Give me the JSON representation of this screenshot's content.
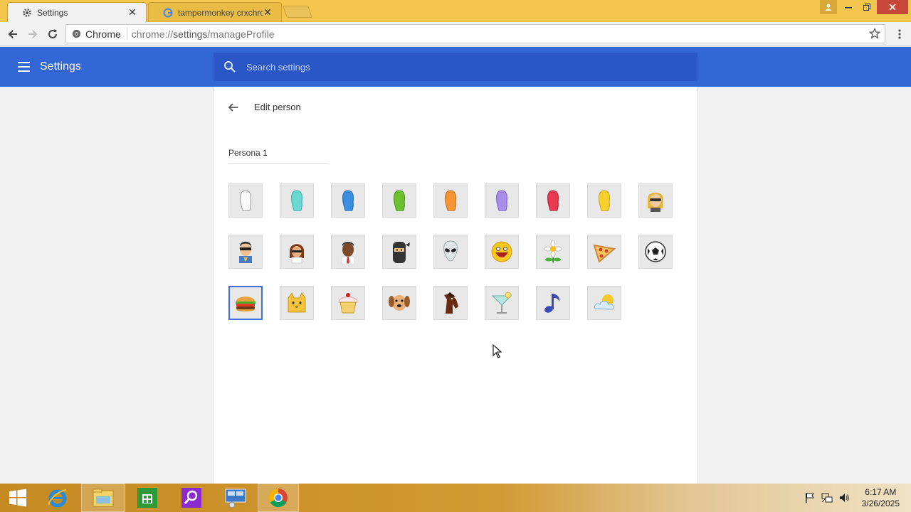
{
  "browser": {
    "tabs": [
      {
        "title": "Settings",
        "close": "✕"
      },
      {
        "title": "tampermonkey crxchrom",
        "close": "✕"
      }
    ],
    "address": {
      "chip_label": "Chrome",
      "url_scheme": "chrome://",
      "url_host": "settings",
      "url_path": "/manageProfile"
    }
  },
  "settings": {
    "title": "Settings",
    "search_placeholder": "Search settings"
  },
  "edit_person": {
    "title": "Edit person",
    "name_value": "Persona 1",
    "selected_avatar": "hamburger",
    "avatars": [
      "generic-white",
      "generic-aqua",
      "generic-blue",
      "generic-green",
      "generic-orange",
      "generic-purple",
      "generic-red",
      "generic-yellow",
      "secret-agent",
      "superhero",
      "volleyball-player",
      "businessman",
      "ninja",
      "alien",
      "awesome",
      "flower",
      "pizza",
      "soccer",
      "hamburger",
      "cat",
      "cupcake",
      "dog",
      "horse",
      "margarita",
      "note",
      "sun-and-cloud"
    ]
  },
  "taskbar": {
    "time": "6:17 AM",
    "date": "3/26/2025",
    "apps": [
      "start",
      "internet-explorer",
      "file-explorer",
      "store",
      "search-app",
      "network-app",
      "chrome"
    ]
  },
  "colors": {
    "title_bar": "#f4c64d",
    "settings_header": "#3367d6",
    "search_bar": "#2a56c6",
    "selected_border": "#3e6ee0"
  }
}
